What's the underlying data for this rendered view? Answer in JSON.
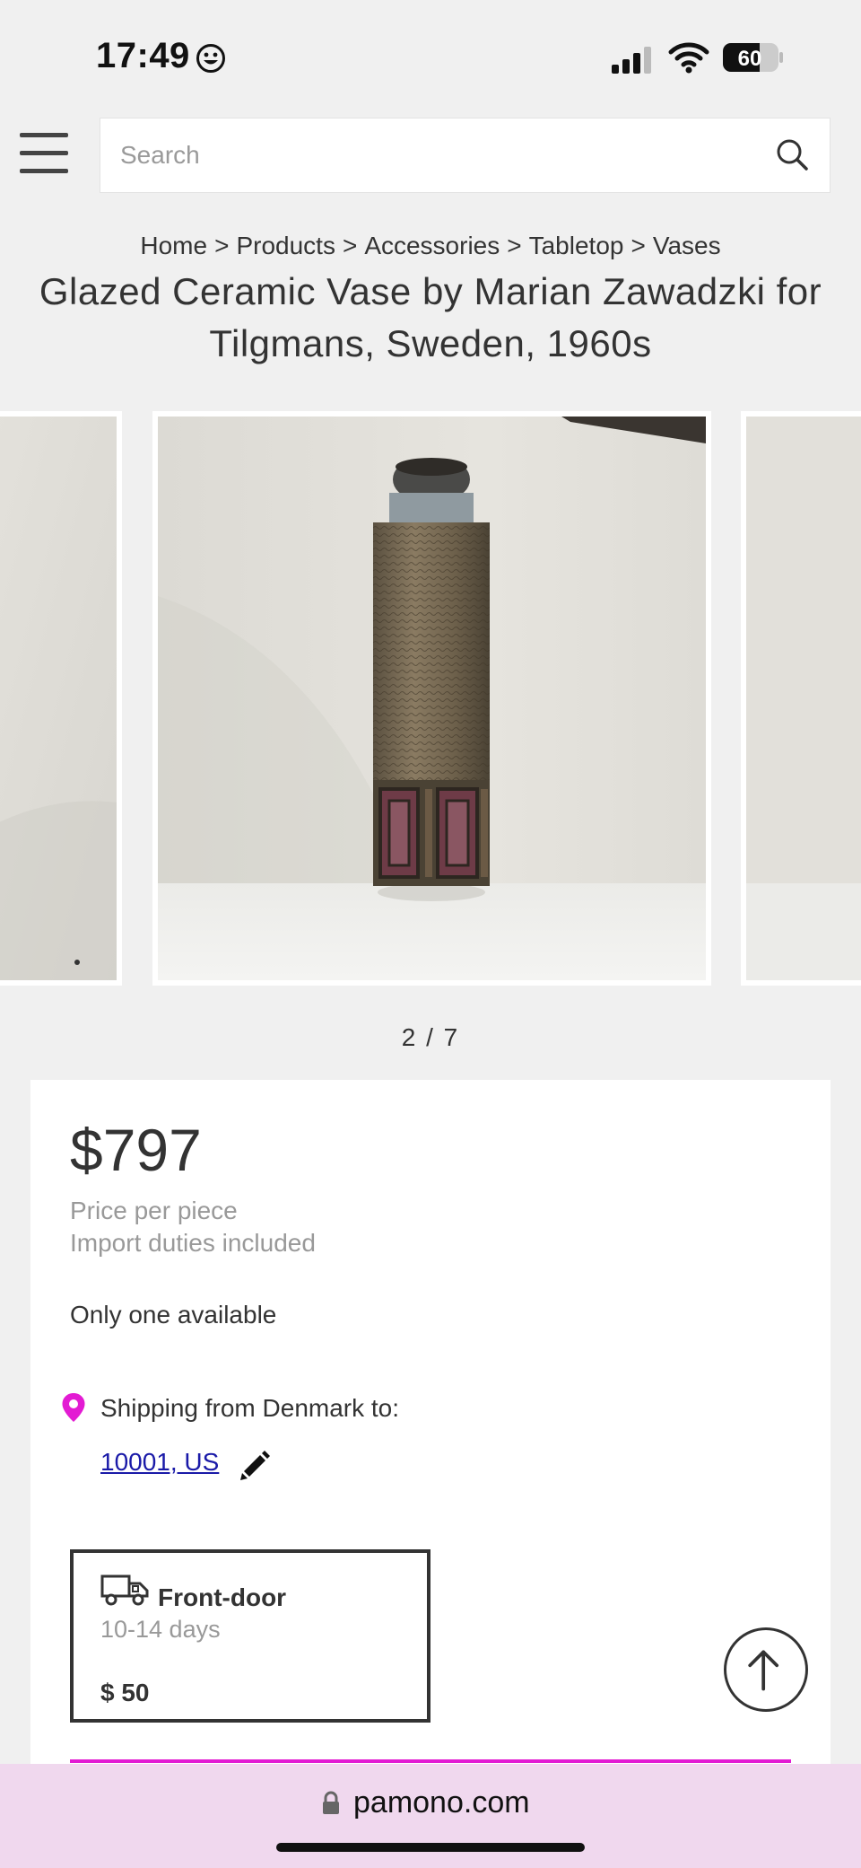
{
  "status_bar": {
    "time": "17:49",
    "battery": "60"
  },
  "search": {
    "placeholder": "Search"
  },
  "breadcrumb": {
    "items": [
      "Home",
      "Products",
      "Accessories",
      "Tabletop",
      "Vases"
    ],
    "separator": ">"
  },
  "product": {
    "title": "Glazed Ceramic Vase by Marian Zawadzki for Tilgmans, Sweden, 1960s",
    "gallery_counter": "2 / 7",
    "price": "$797",
    "price_note_1": "Price per piece",
    "price_note_2": "Import duties included",
    "availability": "Only one available"
  },
  "shipping": {
    "label": "Shipping from Denmark to:",
    "destination": "10001, US"
  },
  "delivery": {
    "title": "Front-door",
    "days": "10-14 days",
    "price": "$ 50"
  },
  "browser": {
    "url": "pamono.com"
  },
  "colors": {
    "accent_pink": "#e31bd3",
    "link_blue": "#1a1aa8",
    "url_bar_bg": "#f0d8ee"
  }
}
